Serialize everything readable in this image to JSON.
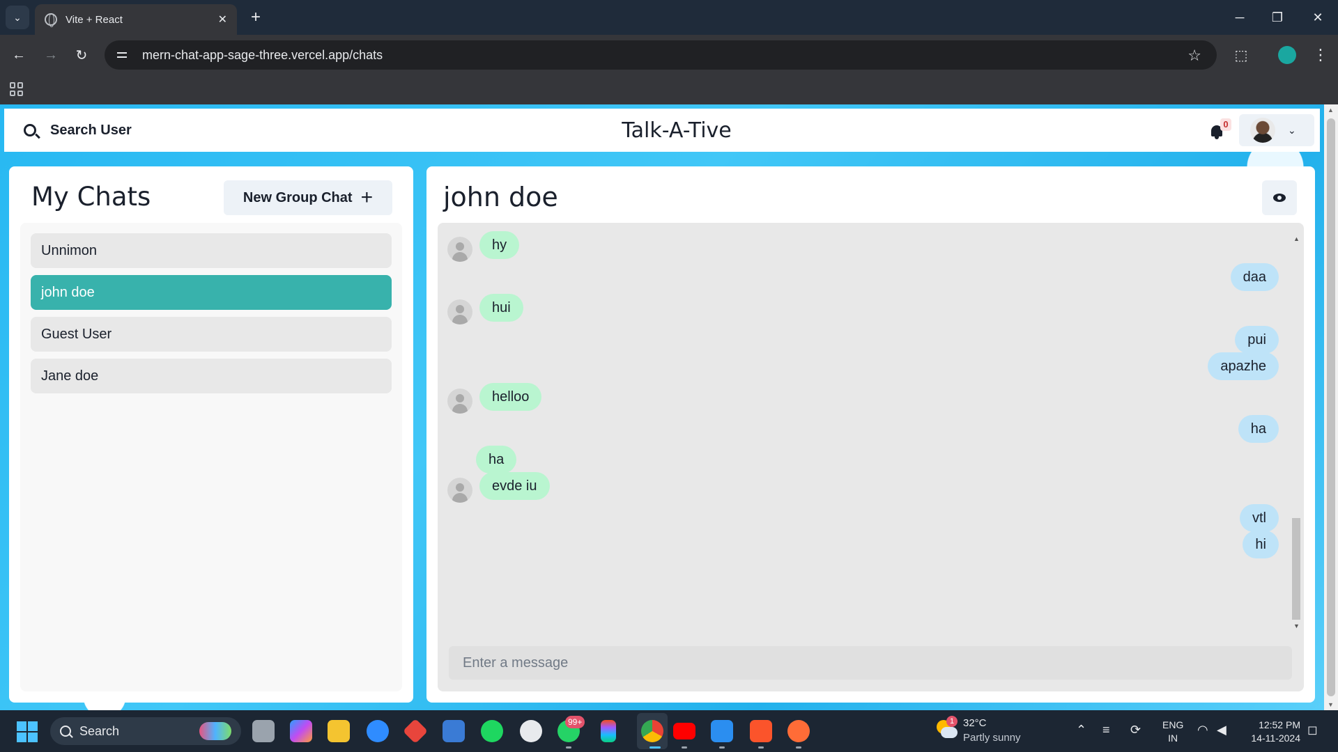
{
  "browser": {
    "tab_title": "Vite + React",
    "tab_close": "✕",
    "new_tab": "+",
    "url": "mern-chat-app-sage-three.vercel.app/chats",
    "window_controls": {
      "minimize": "─",
      "restore": "❐",
      "close": "✕"
    },
    "nav": {
      "back": "←",
      "forward": "→",
      "reload": "↻"
    },
    "star": "☆",
    "extensions": "⬚",
    "menu": "⋮",
    "tabs_dropdown": "⌄"
  },
  "header": {
    "search_label": "Search User",
    "app_title": "Talk-A-Tive",
    "notification_count": "0",
    "chevron": "⌄"
  },
  "sidebar": {
    "title": "My Chats",
    "new_group_label": "New Group Chat",
    "new_group_plus": "+",
    "chats": [
      {
        "name": "Unnimon",
        "active": false
      },
      {
        "name": "john doe",
        "active": true
      },
      {
        "name": "Guest User",
        "active": false
      },
      {
        "name": "Jane doe",
        "active": false
      }
    ]
  },
  "chat": {
    "title": "john doe",
    "messages": [
      {
        "text": "hy",
        "from": "other",
        "avatar": true
      },
      {
        "text": "daa",
        "from": "me"
      },
      {
        "text": "hui",
        "from": "other",
        "avatar": true
      },
      {
        "text": "pui",
        "from": "me"
      },
      {
        "text": "apazhe",
        "from": "me"
      },
      {
        "text": "helloo",
        "from": "other",
        "avatar": true
      },
      {
        "text": "ha",
        "from": "me"
      },
      {
        "text": "ha",
        "from": "other",
        "avatar": false
      },
      {
        "text": "evde iu",
        "from": "other",
        "avatar": true
      },
      {
        "text": "vtl",
        "from": "me"
      },
      {
        "text": "hi",
        "from": "me"
      }
    ],
    "input_placeholder": "Enter a message",
    "input_value": ""
  },
  "taskbar": {
    "search_label": "Search",
    "whatsapp_badge": "99+",
    "weather_badge": "1",
    "weather_temp": "32°C",
    "weather_desc": "Partly sunny",
    "lang_line1": "ENG",
    "lang_line2": "IN",
    "time": "12:52 PM",
    "date": "14-11-2024",
    "tray_chevron": "⌃"
  },
  "colors": {
    "accent_teal": "#38b2ac",
    "incoming_bubble": "#b9f5d0",
    "outgoing_bubble": "#bee3f8",
    "page_background": "#27b8f2"
  }
}
